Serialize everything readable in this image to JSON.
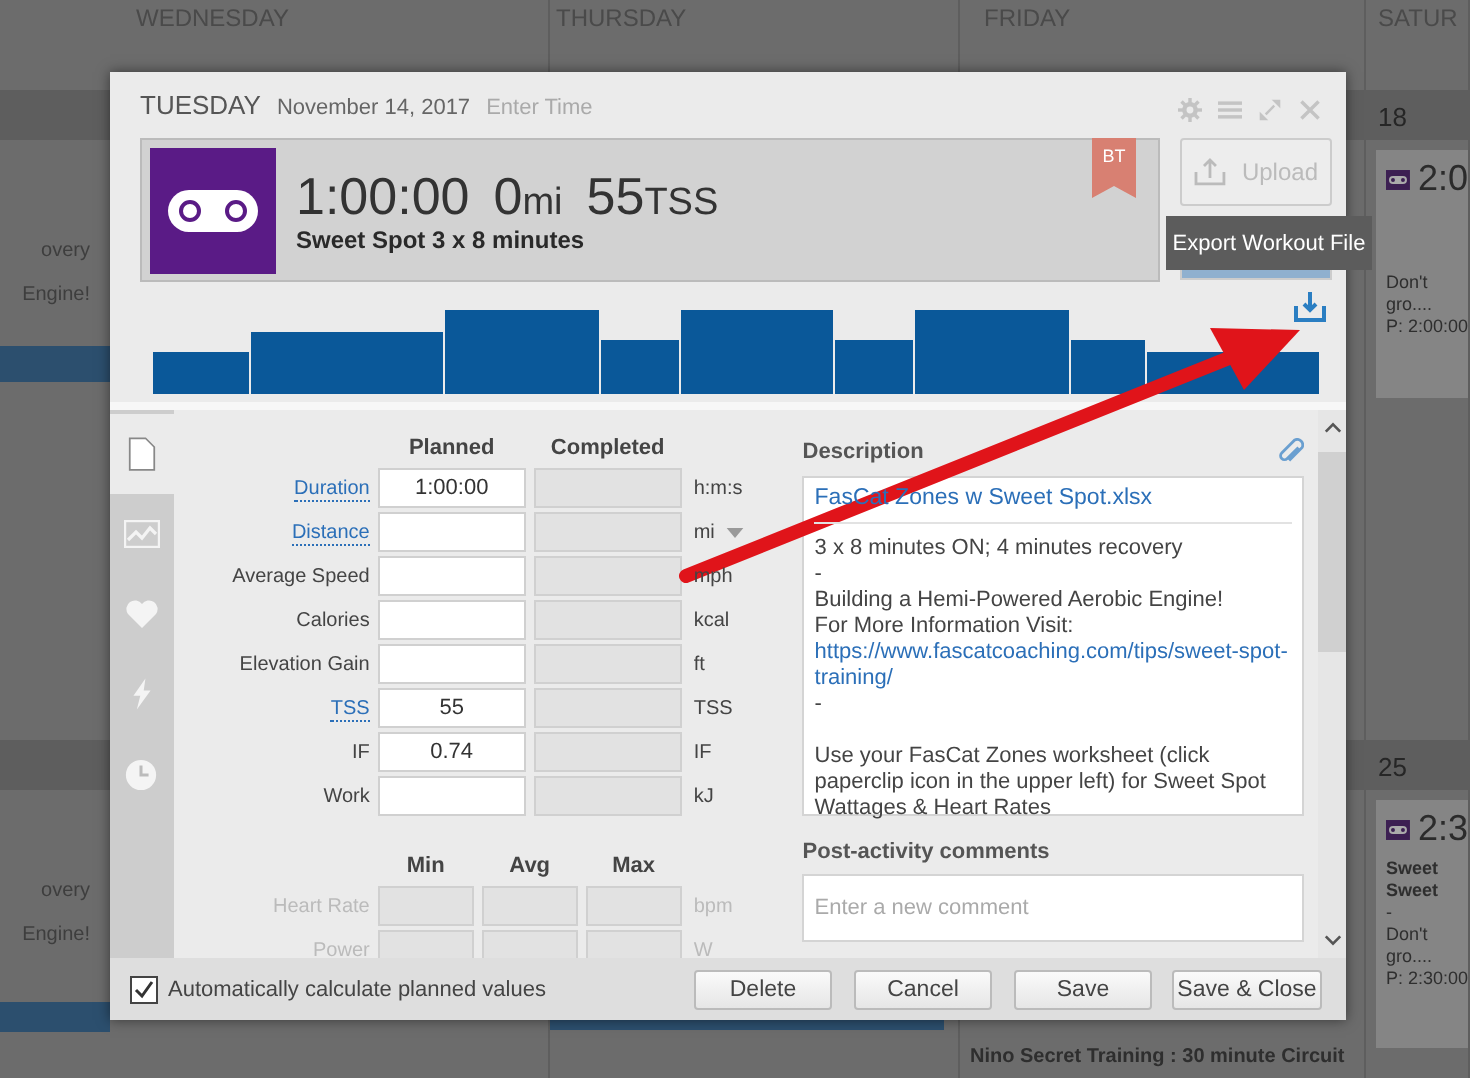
{
  "calendar": {
    "days": [
      "WEDNESDAY",
      "THURSDAY",
      "FRIDAY",
      "SATUR"
    ],
    "weeks": [
      {
        "date": "18",
        "left_lines": [
          "overy",
          "Engine!"
        ],
        "card": {
          "time": "2:0",
          "lines": [
            "Don't",
            "gro....",
            "P: 2:00:00"
          ]
        }
      },
      {
        "date": "25",
        "left_lines": [
          "overy",
          "Engine!"
        ],
        "card": {
          "time": "2:3",
          "lines": [
            "Sweet",
            "Sweet",
            "-",
            "Don't",
            "gro....",
            "P: 2:30:00"
          ]
        },
        "friday_entry": "Nino Secret Training : 30 minute Circuit"
      }
    ]
  },
  "modal": {
    "day": "TUESDAY",
    "date": "November 14, 2017",
    "time_placeholder": "Enter Time",
    "summary": {
      "duration": "1:00:00",
      "distance": "0",
      "distance_unit": "mi",
      "tss": "55",
      "tss_unit": "TSS",
      "title": "Sweet Spot 3 x 8 minutes",
      "badge": "BT"
    },
    "upload_button": "Upload",
    "tooltip": "Export Workout File",
    "tabs": [
      {
        "selected": true
      },
      {
        "selected": false
      },
      {
        "selected": false
      },
      {
        "selected": false
      },
      {
        "selected": false
      }
    ],
    "form": {
      "columns": [
        "Planned",
        "Completed"
      ],
      "rows": [
        {
          "label": "Duration",
          "link": true,
          "planned": "1:00:00",
          "unit": "h:m:s",
          "dropdown": false
        },
        {
          "label": "Distance",
          "link": true,
          "unit": "mi",
          "dropdown": true
        },
        {
          "label": "Average Speed",
          "link": false,
          "unit": "mph",
          "dropdown": false
        },
        {
          "label": "Calories",
          "link": false,
          "unit": "kcal",
          "dropdown": false
        },
        {
          "label": "Elevation Gain",
          "link": false,
          "unit": "ft",
          "dropdown": false
        },
        {
          "label": "TSS",
          "link": true,
          "planned": "55",
          "unit": "TSS",
          "dropdown": false
        },
        {
          "label": "IF",
          "link": false,
          "planned": "0.74",
          "unit": "IF",
          "dropdown": false
        },
        {
          "label": "Work",
          "link": false,
          "unit": "kJ",
          "dropdown": false
        }
      ]
    },
    "range": {
      "columns": [
        "Min",
        "Avg",
        "Max"
      ],
      "rows": [
        {
          "label": "Heart Rate",
          "unit": "bpm"
        },
        {
          "label": "Power",
          "unit": "W"
        }
      ]
    },
    "description": {
      "title": "Description",
      "attachment": "FasCat Zones w Sweet Spot.xlsx",
      "paragraphs": [
        {
          "kind": "text",
          "text": "3 x 8 minutes ON; 4 minutes recovery"
        },
        {
          "kind": "text",
          "text": "-"
        },
        {
          "kind": "text",
          "text": "Building a Hemi-Powered Aerobic Engine!"
        },
        {
          "kind": "text",
          "text": "For More Information Visit:"
        },
        {
          "kind": "link",
          "text": "https://www.fascatcoaching.com/tips/sweet-spot-training/"
        },
        {
          "kind": "text",
          "text": "-"
        },
        {
          "kind": "gap"
        },
        {
          "kind": "text",
          "text": "Use your FasCat Zones worksheet (click paperclip icon in the upper left) for Sweet Spot Wattages & Heart Rates"
        }
      ]
    },
    "comments": {
      "title": "Post-activity comments",
      "placeholder": "Enter a new comment"
    },
    "footer": {
      "auto_calculate": {
        "label": "Automatically calculate planned values",
        "checked": true
      },
      "buttons": [
        "Delete",
        "Cancel",
        "Save",
        "Save & Close"
      ]
    }
  }
}
